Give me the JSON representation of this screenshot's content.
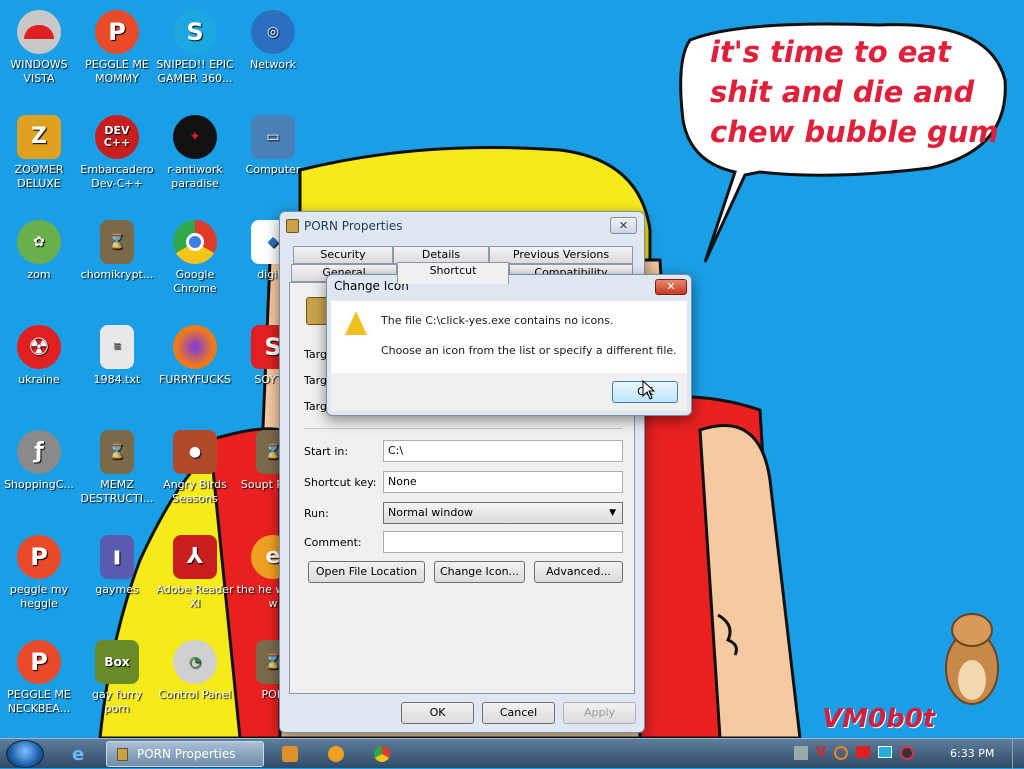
{
  "desktop": {
    "icons": [
      {
        "label": "WINDOWS VISTA",
        "icon": "mushroom-icon",
        "color": "#c8c8c8"
      },
      {
        "label": "PEGGLE ME MOMMY",
        "icon": "peggle-icon",
        "color": "#e84a2a"
      },
      {
        "label": "SNIPED!! EPIC GAMER 360...",
        "icon": "skype-icon",
        "color": "#1ba7e0"
      },
      {
        "label": "Network",
        "icon": "network-icon",
        "color": "#2a6fc0"
      },
      {
        "label": "ZOOMER DELUXE",
        "icon": "zuma-icon",
        "color": "#e0a020"
      },
      {
        "label": "Embarcadero Dev-C++",
        "icon": "devcpp-icon",
        "color": "#c81e1e"
      },
      {
        "label": "r-antiwork paradise",
        "icon": "antiwork-icon",
        "color": "#111111"
      },
      {
        "label": "Computer",
        "icon": "computer-icon",
        "color": "#4a7fb8"
      },
      {
        "label": "zom",
        "icon": "flower-icon",
        "color": "#6ab04a"
      },
      {
        "label": "chomikrypt...",
        "icon": "hourglass-icon",
        "color": "#7a6a4a"
      },
      {
        "label": "Google Chrome",
        "icon": "chrome-icon",
        "color": "#2ea84a"
      },
      {
        "label": "digibr",
        "icon": "digibr-icon",
        "color": "#ffffff"
      },
      {
        "label": "ukraine",
        "icon": "radiation-icon",
        "color": "#e02020"
      },
      {
        "label": "1984.txt",
        "icon": "text-file-icon",
        "color": "#e8e8e8"
      },
      {
        "label": "FURRYFUCKS",
        "icon": "firefox-icon",
        "color": "#f07a1a"
      },
      {
        "label": "SOYTO",
        "icon": "soyto-icon",
        "color": "#e02020"
      },
      {
        "label": "ShoppingC...",
        "icon": "flash-icon",
        "color": "#8a8a8a"
      },
      {
        "label": "MEMZ DESTRUCTI...",
        "icon": "hourglass-icon",
        "color": "#7a6a4a"
      },
      {
        "label": "Angry Birds Seasons",
        "icon": "angry-birds-icon",
        "color": "#b04a2a"
      },
      {
        "label": "Soupt Plays",
        "icon": "hourglass-icon",
        "color": "#7a6a4a"
      },
      {
        "label": "peggle my heggle",
        "icon": "peggle-icon",
        "color": "#e84a2a"
      },
      {
        "label": "gaymes",
        "icon": "games-icon",
        "color": "#5a5ab0"
      },
      {
        "label": "Adobe Reader XI",
        "icon": "pdf-icon",
        "color": "#c81e1e"
      },
      {
        "label": "the he wrong w",
        "icon": "ie-icon",
        "color": "#f0a020"
      },
      {
        "label": "PEGGLE ME NECKBEA...",
        "icon": "peggle-icon",
        "color": "#e84a2a"
      },
      {
        "label": "gay furry porn",
        "icon": "box-icon",
        "color": "#6a8a2a"
      },
      {
        "label": "Control Panel",
        "icon": "control-panel-icon",
        "color": "#d0d0d0"
      },
      {
        "label": "POR",
        "icon": "hourglass-icon",
        "color": "#7a6a4a"
      }
    ],
    "speech_bubble": "it's time to eat shit and die and chew bubble gum",
    "signature": "VM0b0t"
  },
  "properties_window": {
    "title": "PORN Properties",
    "close_label": "✕",
    "tabs_row1": [
      "Security",
      "Details",
      "Previous Versions"
    ],
    "tabs_row2": [
      "General",
      "Shortcut",
      "Compatibility"
    ],
    "target_labels": [
      "Targe",
      "Targe",
      "Targe"
    ],
    "start_in_label": "Start in:",
    "start_in_value": "C:\\",
    "shortcut_key_label": "Shortcut key:",
    "shortcut_key_value": "None",
    "run_label": "Run:",
    "run_value": "Normal window",
    "comment_label": "Comment:",
    "comment_value": "",
    "open_file_location": "Open File Location",
    "change_icon": "Change Icon...",
    "advanced": "Advanced...",
    "ok": "OK",
    "cancel": "Cancel",
    "apply": "Apply"
  },
  "change_icon_dialog": {
    "title": "Change Icon",
    "close_label": "✕",
    "message1": "The file C:\\click-yes.exe contains no icons.",
    "message2": "Choose an icon from the list or specify a different file.",
    "ok": "OK"
  },
  "taskbar": {
    "active_window": "PORN Properties",
    "clock": "6:33 PM"
  }
}
